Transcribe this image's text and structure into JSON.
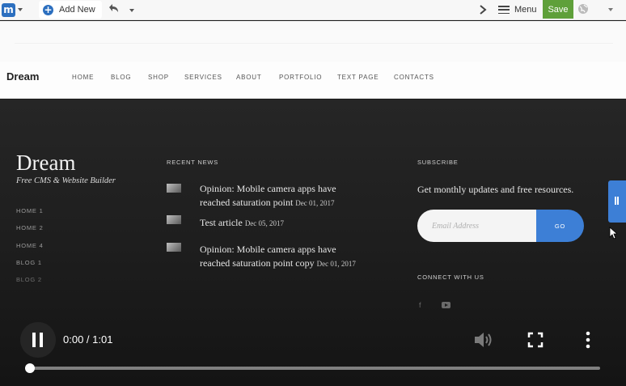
{
  "toolbar": {
    "logo_icon": "site-builder-logo-icon",
    "add_new_label": "Add New",
    "menu_label": "Menu",
    "save_label": "Save",
    "accent_color": "#2c6fbf",
    "save_color": "#5fa03a"
  },
  "site_nav": {
    "brand": "Dream",
    "items": [
      {
        "label": "HOME"
      },
      {
        "label": "BLOG"
      },
      {
        "label": "SHOP"
      },
      {
        "label": "SERVICES"
      },
      {
        "label": "ABOUT"
      },
      {
        "label": "PORTFOLIO"
      },
      {
        "label": "TEXT PAGE"
      },
      {
        "label": "CONTACTS"
      }
    ]
  },
  "footer": {
    "brand": "Dream",
    "tagline": "Free CMS & Website Builder",
    "links": [
      {
        "label": "HOME 1"
      },
      {
        "label": "HOME 2"
      },
      {
        "label": "HOME 4"
      },
      {
        "label": "BLOG 1"
      },
      {
        "label": "BLOG 2"
      }
    ],
    "recent_news": {
      "heading": "RECENT NEWS",
      "items": [
        {
          "title": "Opinion: Mobile camera apps have reached saturation point",
          "date": "Dec 01, 2017"
        },
        {
          "title": "Test article",
          "date": "Dec 05, 2017"
        },
        {
          "title": "Opinion: Mobile camera apps have reached saturation point copy",
          "date": "Dec 01, 2017"
        }
      ]
    },
    "subscribe": {
      "heading": "SUBSCRIBE",
      "text": "Get monthly updates and free resources.",
      "email_placeholder": "Email Address",
      "button_label": "GO",
      "button_color": "#3d7fd6"
    },
    "connect": {
      "heading": "CONNECT WITH US",
      "icons": [
        "facebook-icon",
        "youtube-icon"
      ]
    }
  },
  "video": {
    "time": "0:00 / 1:01",
    "progress_fraction": 0.0
  }
}
